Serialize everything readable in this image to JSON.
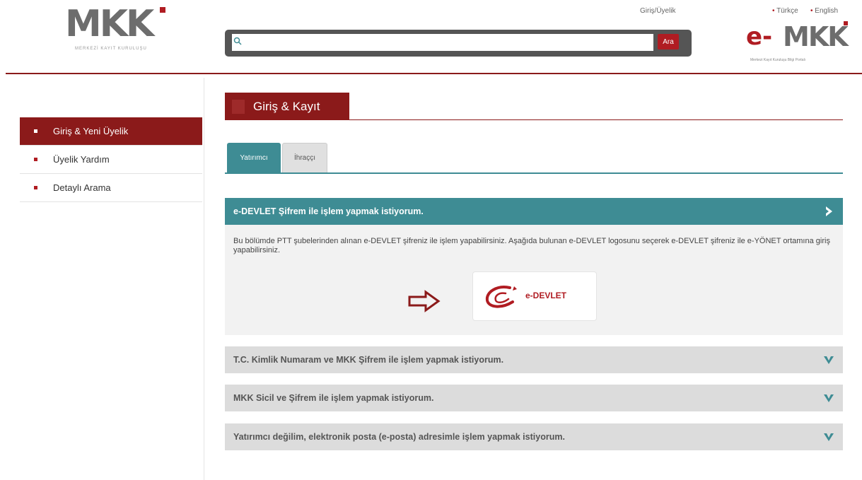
{
  "header": {
    "logo_word": "MKK",
    "logo_sub": "MERKEZİ KAYIT KURULUŞU",
    "login_link": "Giriş/Üyelik",
    "lang_turkce": "Türkçe",
    "lang_english": "English",
    "lang_bullet": "•",
    "search_placeholder": "",
    "search_button": "Ara",
    "emkk_prefix": "e-",
    "emkk_word": "MKK",
    "emkk_sub": "Merkezi Kayıt Kuruluşu Bilgi Portalı"
  },
  "sidebar": {
    "items": [
      {
        "label": "Giriş & Yeni Üyelik",
        "active": true
      },
      {
        "label": "Üyelik Yardım",
        "active": false
      },
      {
        "label": "Detaylı Arama",
        "active": false
      }
    ]
  },
  "main": {
    "title": "Giriş & Kayıt",
    "tabs": [
      {
        "label": "Yatırımcı",
        "active": true
      },
      {
        "label": "İhraççı",
        "active": false
      }
    ],
    "accordion": [
      {
        "title": "e-DEVLET Şifrem ile işlem yapmak istiyorum.",
        "open": true,
        "body": "Bu bölümde PTT şubelerinden alınan e-DEVLET şifreniz ile işlem yapabilirsiniz. Aşağıda bulunan e-DEVLET logosunu seçerek e-DEVLET şifreniz ile e-YÖNET ortamına giriş yapabilirsiniz.",
        "logo_text": "e-DEVLET"
      },
      {
        "title": "T.C. Kimlik Numaram ve MKK Şifrem ile işlem yapmak istiyorum.",
        "open": false
      },
      {
        "title": "MKK Sicil ve Şifrem ile işlem yapmak istiyorum.",
        "open": false
      },
      {
        "title": "Yatırımcı değilim, elektronik posta (e-posta) adresimle işlem yapmak istiyorum.",
        "open": false
      }
    ]
  },
  "colors": {
    "brand_red": "#8b1a1a",
    "accent_red": "#b01c22",
    "teal": "#3e8c94"
  }
}
